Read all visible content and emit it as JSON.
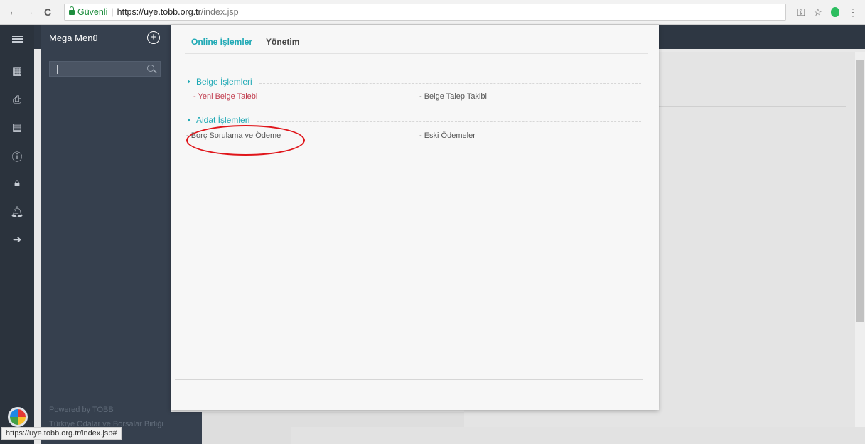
{
  "browser": {
    "secure_label": "Güvenli",
    "url_host": "https://uye.tobb.org.tr",
    "url_path": "/index.jsp",
    "status_url": "https://uye.tobb.org.tr/index.jsp#",
    "back_glyph": "←",
    "forward_glyph": "→",
    "reload_glyph": "C",
    "key_glyph": "⚿",
    "star_glyph": "☆",
    "menu_glyph": "⋮"
  },
  "sidebar": {
    "title": "Mega Menü",
    "plus_glyph": "+",
    "search_placeholder": "",
    "footer_line1": "Powered by TOBB",
    "footer_line2": "Türkiye Odalar ve Borsalar Birliği",
    "rail_icons": [
      {
        "name": "calendar-icon",
        "glyph": "▦"
      },
      {
        "name": "print-icon",
        "glyph": "⎙"
      },
      {
        "name": "calculator-icon",
        "glyph": "▤"
      },
      {
        "name": "info-icon",
        "glyph": "ⓘ"
      },
      {
        "name": "lock-icon",
        "glyph": "🔒︎"
      },
      {
        "name": "bell-icon",
        "glyph": "🔔︎"
      },
      {
        "name": "logout-icon",
        "glyph": "➜"
      }
    ]
  },
  "mega_panel": {
    "tabs": [
      {
        "label": "Online İşlemler",
        "active": true
      },
      {
        "label": "Yönetim",
        "active": false
      }
    ],
    "sections": [
      {
        "title": "Belge İşlemleri",
        "links": [
          "- Yeni Belge Talebi",
          "- Belge Talep Takibi"
        ]
      },
      {
        "title": "Aidat İşlemleri",
        "links": [
          "- Borç Sorulama ve Ödeme",
          "- Eski Ödemeler"
        ]
      }
    ]
  },
  "colors": {
    "accent": "#1fa9b5",
    "link_red": "#c0394b",
    "annotation": "#e0161b",
    "sidebar_bg": "#36404e",
    "rail_bg": "#2b333d"
  }
}
